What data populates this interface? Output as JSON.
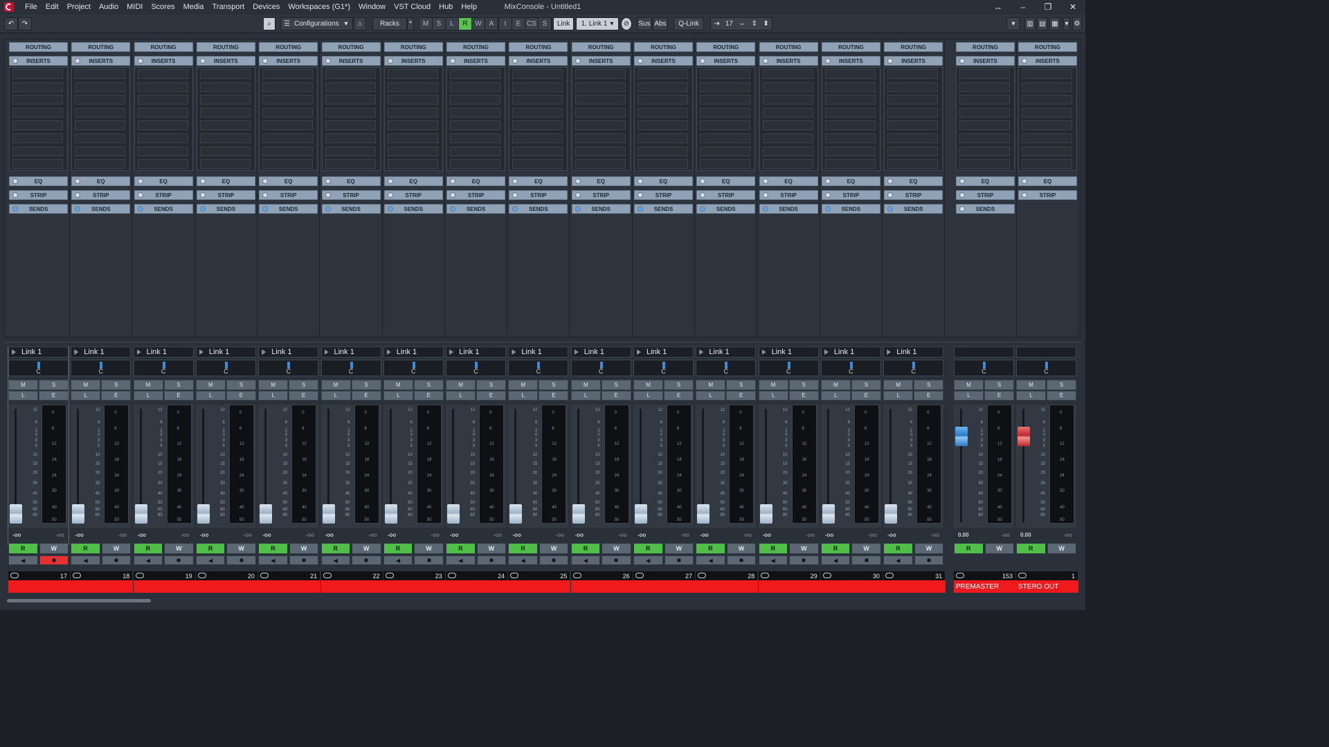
{
  "menu": {
    "items": [
      "File",
      "Edit",
      "Project",
      "Audio",
      "MIDI",
      "Scores",
      "Media",
      "Transport",
      "Devices",
      "Workspaces (G1*)",
      "Window",
      "VST Cloud",
      "Hub",
      "Help"
    ],
    "title": "MixConsole - Untitled1"
  },
  "toolbar": {
    "configurations": "Configurations",
    "racks": "Racks",
    "racks_star": "*",
    "state_buttons": [
      "M",
      "S",
      "L",
      "R",
      "W",
      "A"
    ],
    "filter_buttons": [
      "I",
      "E",
      "CS",
      "S"
    ],
    "link_label": "Link",
    "link_value": "1. Link 1",
    "sus": "Sus",
    "abs": "Abs",
    "qlink": "Q-Link",
    "channel_count": "17"
  },
  "rack": {
    "routing": "ROUTING",
    "inserts": "INSERTS",
    "eq": "EQ",
    "strip": "STRIP",
    "sends": "SENDS"
  },
  "channels": [
    {
      "name": "Link 1",
      "number": "17",
      "pan": "C",
      "fader_val": "-oo",
      "meter_val": "-oo",
      "selected": true,
      "rec": true
    },
    {
      "name": "Link 1",
      "number": "18",
      "pan": "C",
      "fader_val": "-oo",
      "meter_val": "-oo"
    },
    {
      "name": "Link 1",
      "number": "19",
      "pan": "C",
      "fader_val": "-oo",
      "meter_val": "-oo"
    },
    {
      "name": "Link 1",
      "number": "20",
      "pan": "C",
      "fader_val": "-oo",
      "meter_val": "-oo"
    },
    {
      "name": "Link 1",
      "number": "21",
      "pan": "C",
      "fader_val": "-oo",
      "meter_val": "-oo"
    },
    {
      "name": "Link 1",
      "number": "22",
      "pan": "C",
      "fader_val": "-oo",
      "meter_val": "-oo"
    },
    {
      "name": "Link 1",
      "number": "23",
      "pan": "C",
      "fader_val": "-oo",
      "meter_val": "-oo"
    },
    {
      "name": "Link 1",
      "number": "24",
      "pan": "C",
      "fader_val": "-oo",
      "meter_val": "-oo"
    },
    {
      "name": "Link 1",
      "number": "25",
      "pan": "C",
      "fader_val": "-oo",
      "meter_val": "-oo"
    },
    {
      "name": "Link 1",
      "number": "26",
      "pan": "C",
      "fader_val": "-oo",
      "meter_val": "-oo"
    },
    {
      "name": "Link 1",
      "number": "27",
      "pan": "C",
      "fader_val": "-oo",
      "meter_val": "-oo"
    },
    {
      "name": "Link 1",
      "number": "28",
      "pan": "C",
      "fader_val": "-oo",
      "meter_val": "-oo"
    },
    {
      "name": "Link 1",
      "number": "29",
      "pan": "C",
      "fader_val": "-oo",
      "meter_val": "-oo"
    },
    {
      "name": "Link 1",
      "number": "30",
      "pan": "C",
      "fader_val": "-oo",
      "meter_val": "-oo"
    },
    {
      "name": "Link 1",
      "number": "31",
      "pan": "C",
      "fader_val": "-oo",
      "meter_val": "-oo"
    }
  ],
  "outputs": [
    {
      "name": "",
      "number": "153",
      "pan": "C",
      "fader_val": "0.00",
      "meter_val": "-oo",
      "label": "PREMASTER",
      "knob": "blue"
    },
    {
      "name": "",
      "number": "1",
      "pan": "C",
      "fader_val": "0.00",
      "meter_val": "-oo",
      "label": "STERO OUT",
      "knob": "red"
    }
  ],
  "strip_buttons": {
    "m": "M",
    "s": "S",
    "l": "L",
    "e": "E",
    "r": "R",
    "w": "W"
  },
  "fader_scale": [
    "12",
    "6",
    "2",
    "0",
    "3",
    "5",
    "10",
    "15",
    "20",
    "30",
    "40",
    "50",
    "60",
    "80"
  ],
  "meter_scale": [
    "0",
    "6",
    "12",
    "18",
    "24",
    "30",
    "40",
    "50"
  ],
  "colors": {
    "accent_red": "#f0191b",
    "read_green": "#4fbf48",
    "pan_blue": "#3d8ce0"
  }
}
